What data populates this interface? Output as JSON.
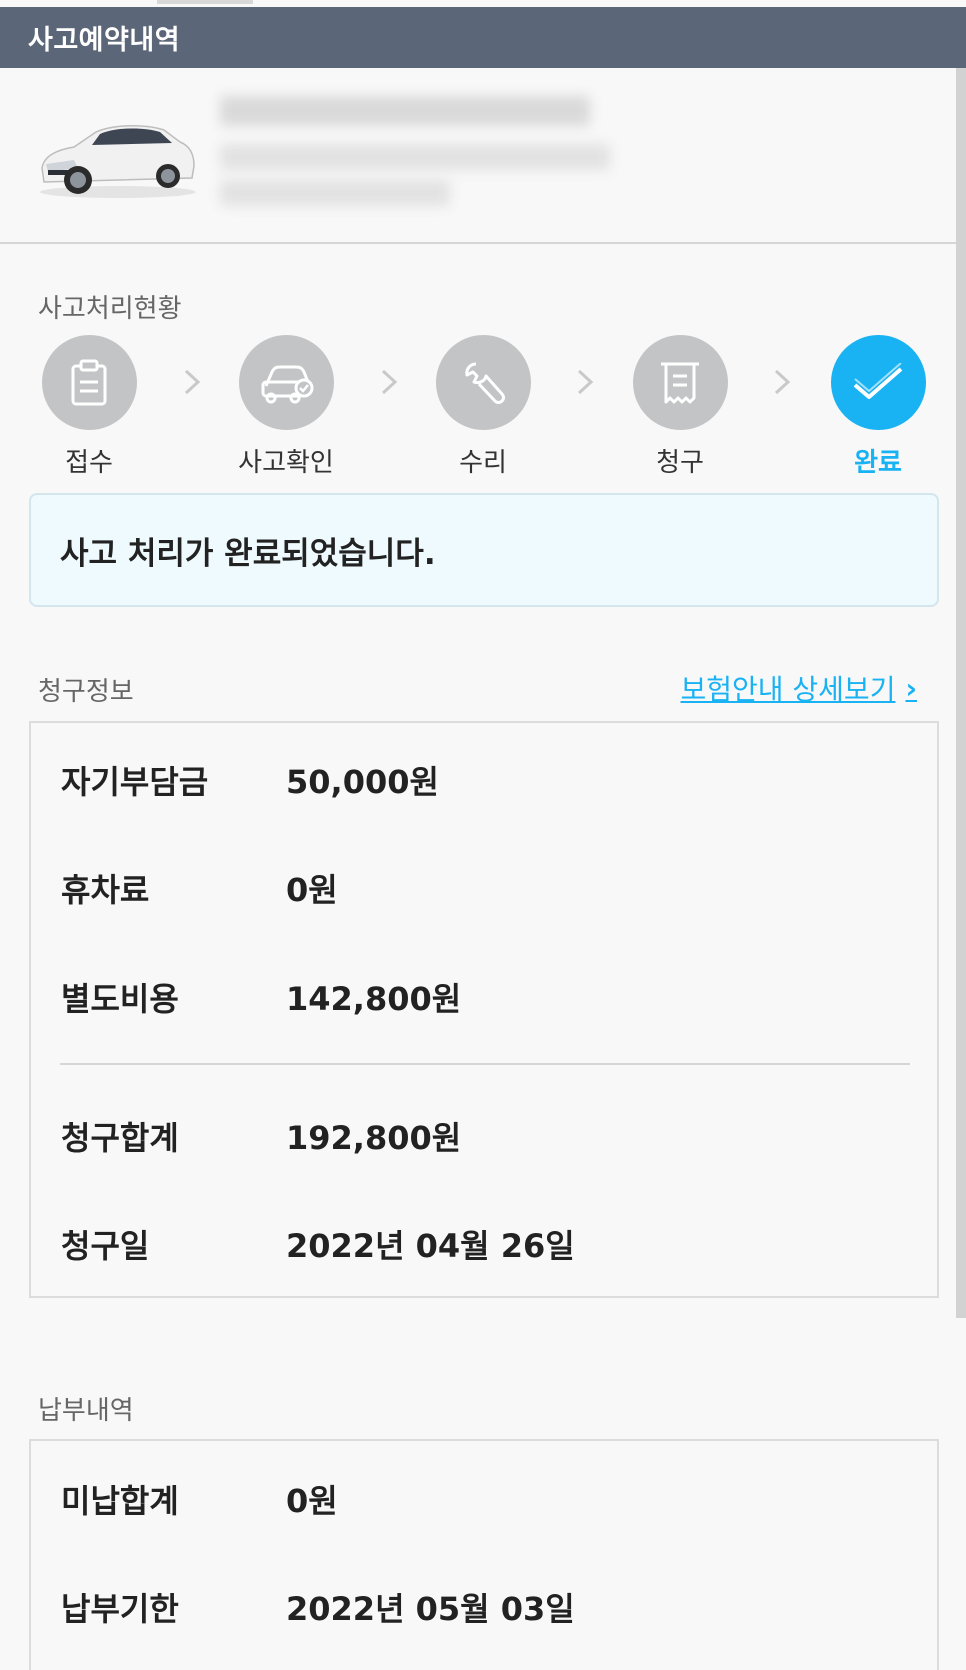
{
  "header": {
    "title": "사고예약내역"
  },
  "car": {
    "image": "car-photo",
    "info_blurred": true
  },
  "process": {
    "section_label": "사고처리현황",
    "steps": [
      {
        "label": "접수",
        "icon": "clipboard-icon",
        "active": false
      },
      {
        "label": "사고확인",
        "icon": "car-check-icon",
        "active": false
      },
      {
        "label": "수리",
        "icon": "wrench-icon",
        "active": false
      },
      {
        "label": "청구",
        "icon": "receipt-icon",
        "active": false
      },
      {
        "label": "완료",
        "icon": "check-icon",
        "active": true
      }
    ],
    "notice": "사고 처리가 완료되었습니다."
  },
  "billing": {
    "section_label": "청구정보",
    "detail_link": "보험안내 상세보기",
    "rows": [
      {
        "key": "자기부담금",
        "value": "50,000원"
      },
      {
        "key": "휴차료",
        "value": "0원"
      },
      {
        "key": "별도비용",
        "value": "142,800원"
      }
    ],
    "total": {
      "key": "청구합계",
      "value": "192,800원"
    },
    "date": {
      "key": "청구일",
      "value": "2022년 04월 26일"
    }
  },
  "payment": {
    "section_label": "납부내역",
    "rows": [
      {
        "key": "미납합계",
        "value": "0원"
      },
      {
        "key": "납부기한",
        "value": "2022년 05월 03일"
      }
    ]
  },
  "colors": {
    "appbar": "#5b6778",
    "accent": "#19b2f2",
    "step_inactive": "#c3c4c5",
    "notice_bg": "#eefafd"
  }
}
